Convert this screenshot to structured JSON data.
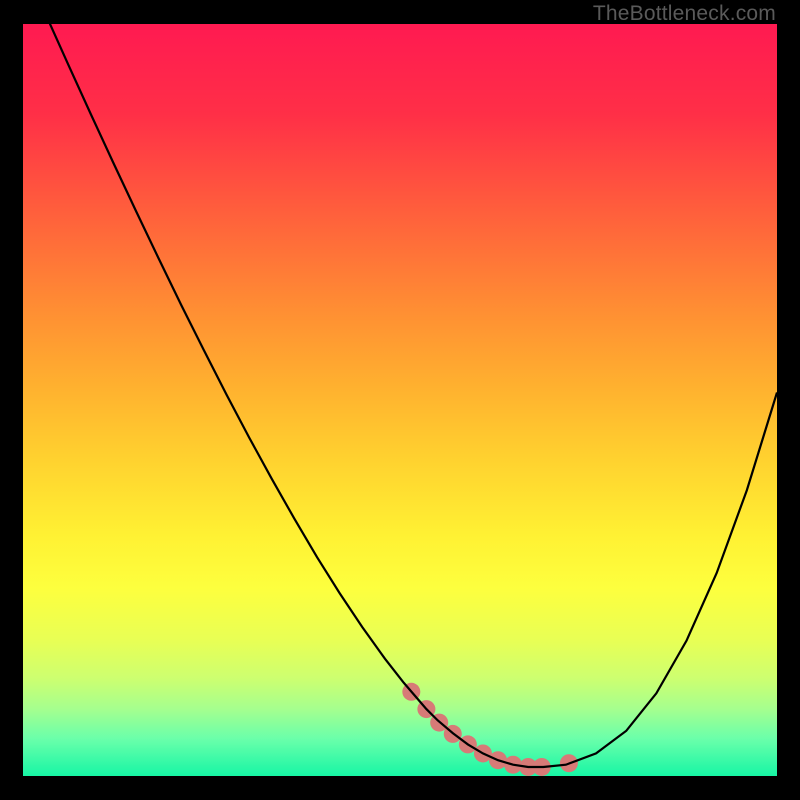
{
  "watermark": {
    "text": "TheBottleneck.com"
  },
  "colors": {
    "black": "#000000",
    "curve": "#000000",
    "marker": "#d77a77"
  },
  "chart_data": {
    "type": "line",
    "title": "",
    "xlabel": "",
    "ylabel": "",
    "xlim": [
      0,
      100
    ],
    "ylim": [
      0,
      100
    ],
    "grid": false,
    "legend": false,
    "series": [
      {
        "name": "bottleneck-curve",
        "x": [
          0,
          3,
          6,
          9,
          12,
          15,
          18,
          21,
          24,
          27,
          30,
          33,
          36,
          39,
          42,
          45,
          48,
          50.5,
          53.5,
          55,
          57,
          59,
          61,
          63,
          65,
          67,
          69,
          72,
          76,
          80,
          84,
          88,
          92,
          96,
          100
        ],
        "y": [
          108.1,
          101.3,
          94.6,
          88,
          81.5,
          75.1,
          68.8,
          62.6,
          56.6,
          50.7,
          45,
          39.5,
          34.2,
          29.1,
          24.3,
          19.8,
          15.6,
          12.4,
          8.9,
          7.4,
          5.7,
          4.2,
          3,
          2.1,
          1.5,
          1.2,
          1.2,
          1.5,
          3,
          6,
          11,
          18,
          27,
          38,
          51
        ]
      }
    ],
    "markers": {
      "name": "optimal-range-markers",
      "x": [
        51.5,
        53.5,
        55.2,
        57,
        59,
        61,
        63,
        65,
        67,
        68.8,
        72.4
      ],
      "y": [
        11.2,
        8.9,
        7.1,
        5.6,
        4.2,
        3,
        2.1,
        1.5,
        1.2,
        1.2,
        1.7
      ],
      "color": "#d77a77",
      "radius_px": 9
    },
    "gradient_stops": [
      {
        "offset": 0,
        "color": "#ff1a51"
      },
      {
        "offset": 0.12,
        "color": "#ff2f47"
      },
      {
        "offset": 0.25,
        "color": "#ff5f3c"
      },
      {
        "offset": 0.38,
        "color": "#ff8e33"
      },
      {
        "offset": 0.48,
        "color": "#ffb02f"
      },
      {
        "offset": 0.58,
        "color": "#ffd22f"
      },
      {
        "offset": 0.68,
        "color": "#fff133"
      },
      {
        "offset": 0.75,
        "color": "#fdff3e"
      },
      {
        "offset": 0.82,
        "color": "#e8ff55"
      },
      {
        "offset": 0.87,
        "color": "#cdff70"
      },
      {
        "offset": 0.91,
        "color": "#a6ff8e"
      },
      {
        "offset": 0.95,
        "color": "#6bffaa"
      },
      {
        "offset": 1.0,
        "color": "#17f6a5"
      }
    ]
  }
}
